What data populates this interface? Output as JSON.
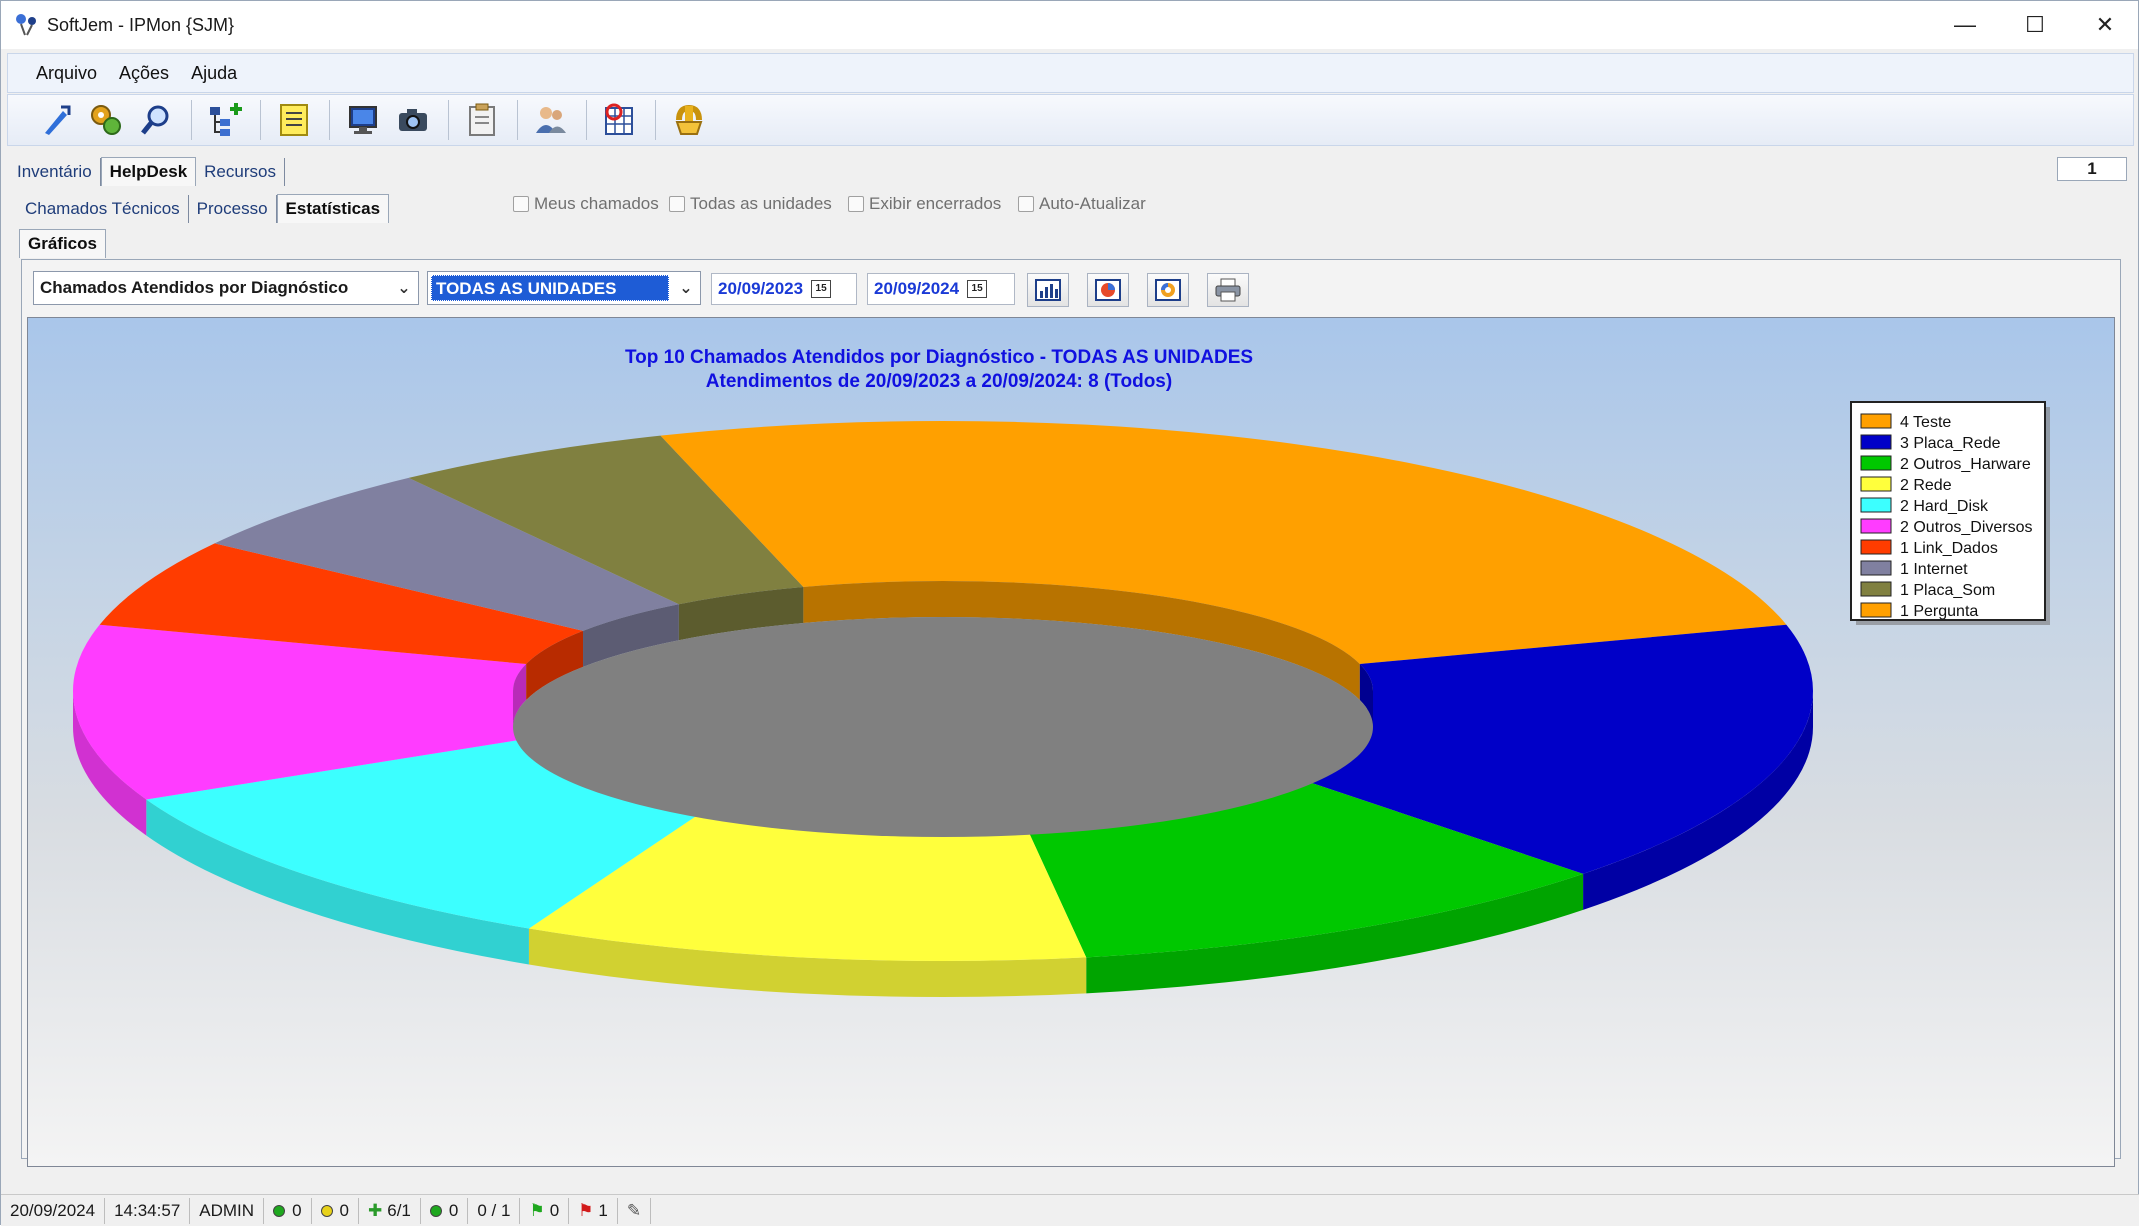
{
  "window": {
    "title": "SoftJem - IPMon {SJM}",
    "controls": {
      "minimize": "—",
      "maximize": "☐",
      "close": "✕"
    }
  },
  "menu": [
    "Arquivo",
    "Ações",
    "Ajuda"
  ],
  "toolbar_icons": [
    "connect-icon",
    "tools-icon",
    "search-icon",
    "tree-add-icon",
    "notes-icon",
    "monitor-icon",
    "camera-icon",
    "clipboard-icon",
    "users-icon",
    "report-icon",
    "exit-icon"
  ],
  "main_tabs": [
    {
      "label": "Inventário",
      "active": false
    },
    {
      "label": "HelpDesk",
      "active": true
    },
    {
      "label": "Recursos",
      "active": false
    }
  ],
  "counter": "1",
  "sub_tabs": [
    {
      "label": "Chamados Técnicos",
      "active": false
    },
    {
      "label": "Processo",
      "active": false
    },
    {
      "label": "Estatísticas",
      "active": true
    }
  ],
  "graf_tabs": [
    {
      "label": "Gráficos",
      "active": true
    }
  ],
  "checkboxes": [
    {
      "label": "Meus chamados",
      "checked": false
    },
    {
      "label": "Todas as unidades",
      "checked": false
    },
    {
      "label": "Exibir encerrados",
      "checked": false
    },
    {
      "label": "Auto-Atualizar",
      "checked": false
    }
  ],
  "filters": {
    "report": "Chamados Atendidos por Diagnóstico",
    "unit": "TODAS AS UNIDADES",
    "date_from": "20/09/2023",
    "date_to": "20/09/2024",
    "calendar_glyph": "15"
  },
  "chart_data": {
    "type": "pie",
    "style": "3d-doughnut",
    "title": "Top 10 Chamados Atendidos por Diagnóstico - TODAS AS UNIDADES",
    "subtitle": "Atendimentos de 20/09/2023 a 20/09/2024: 8 (Todos)",
    "legend_position": "top-right",
    "slices": [
      {
        "label": "Teste",
        "legend": "4 Teste",
        "value": 4,
        "color": "#ffa000"
      },
      {
        "label": "Placa_Rede",
        "legend": "3 Placa_Rede",
        "value": 3,
        "color": "#0000c8"
      },
      {
        "label": "Outros_Harware",
        "legend": "2 Outros_Harware",
        "value": 2,
        "color": "#00c800"
      },
      {
        "label": "Rede",
        "legend": "2 Rede",
        "value": 2,
        "color": "#ffff3c"
      },
      {
        "label": "Hard_Disk",
        "legend": "2 Hard_Disk",
        "value": 2,
        "color": "#3cffff"
      },
      {
        "label": "Outros_Diversos",
        "legend": "2 Outros_Diversos",
        "value": 2,
        "color": "#ff3cff"
      },
      {
        "label": "Link_Dados",
        "legend": "1 Link_Dados",
        "value": 1,
        "color": "#ff3c00"
      },
      {
        "label": "Internet",
        "legend": "1 Internet",
        "value": 1,
        "color": "#8080a0"
      },
      {
        "label": "Placa_Som",
        "legend": "1 Placa_Som",
        "value": 1,
        "color": "#808040"
      },
      {
        "label": "Pergunta",
        "legend": "1 Pergunta",
        "value": 1,
        "color": "#ffa000"
      }
    ],
    "title_color": "#1010e0"
  },
  "status": {
    "date": "20/09/2024",
    "time": "14:34:57",
    "user": "ADMIN",
    "green1": "0",
    "yellow": "0",
    "plus_count": "6/1",
    "green2": "0",
    "ratio": "0 / 1",
    "flag_green": "0",
    "flag_red": "1"
  }
}
